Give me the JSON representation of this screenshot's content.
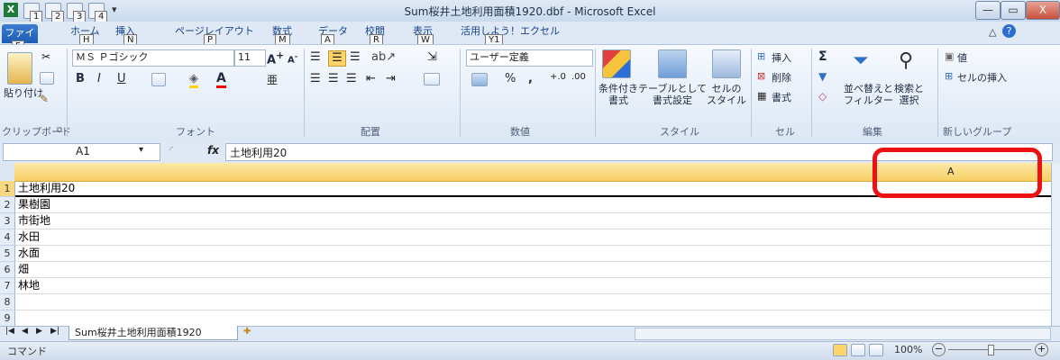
{
  "window": {
    "title": "Sum桜井土地利用面積1920.dbf - Microsoft Excel",
    "controls": {
      "minimize": "—",
      "restore": "▭",
      "close": "X"
    }
  },
  "qat_keytips": [
    "1",
    "2",
    "3",
    "4"
  ],
  "tabs": [
    {
      "label": "ファイル",
      "keytip": "F"
    },
    {
      "label": "ホーム",
      "keytip": "H"
    },
    {
      "label": "挿入",
      "keytip": "N"
    },
    {
      "label": "ページレイアウト",
      "keytip": "P"
    },
    {
      "label": "数式",
      "keytip": "M"
    },
    {
      "label": "データ",
      "keytip": "A"
    },
    {
      "label": "校閲",
      "keytip": "R"
    },
    {
      "label": "表示",
      "keytip": "W"
    },
    {
      "label": "活用しよう！エクセル",
      "keytip": "Y1"
    }
  ],
  "ribbon": {
    "clipboard": {
      "group_label": "クリップボード",
      "paste_label": "貼り付け"
    },
    "font": {
      "group_label": "フォント",
      "font_name": "ＭＳ Ｐゴシック",
      "font_size": "11",
      "bold": "B",
      "italic": "I",
      "underline": "U",
      "font_color_glyph": "A"
    },
    "alignment": {
      "group_label": "配置"
    },
    "number": {
      "group_label": "数値",
      "format": "ユーザー定義",
      "percent": "%",
      "comma": ","
    },
    "styles": {
      "group_label": "スタイル",
      "conditional": "条件付き\n書式",
      "table": "テーブルとして\n書式設定",
      "cell_style": "セルの\nスタイル"
    },
    "cells": {
      "group_label": "セル",
      "insert": "挿入",
      "delete": "削除",
      "format": "書式"
    },
    "editing": {
      "group_label": "編集",
      "sum": "Σ",
      "sort": "並べ替えと\nフィルター",
      "find": "検索と\n選択"
    },
    "new_group": {
      "group_label": "新しいグループ",
      "item1": "値",
      "item2": "セルの挿入"
    }
  },
  "formula_bar": {
    "name_box": "A1",
    "fx": "fx",
    "content": "土地利用20"
  },
  "grid": {
    "column_header": "A",
    "rows": [
      {
        "num": "1",
        "value": "土地利用20"
      },
      {
        "num": "2",
        "value": "果樹園"
      },
      {
        "num": "3",
        "value": "市街地"
      },
      {
        "num": "4",
        "value": "水田"
      },
      {
        "num": "5",
        "value": "水面"
      },
      {
        "num": "6",
        "value": "畑"
      },
      {
        "num": "7",
        "value": "林地"
      },
      {
        "num": "8",
        "value": ""
      },
      {
        "num": "9",
        "value": ""
      }
    ]
  },
  "sheet_tab": "Sum桜井土地利用面積1920",
  "status": {
    "mode": "コマンド",
    "zoom": "100%"
  },
  "colors": {
    "accent_file_tab": "#1e5cb3",
    "highlight": "#ee1111",
    "header_selected": "#f7cf63"
  }
}
